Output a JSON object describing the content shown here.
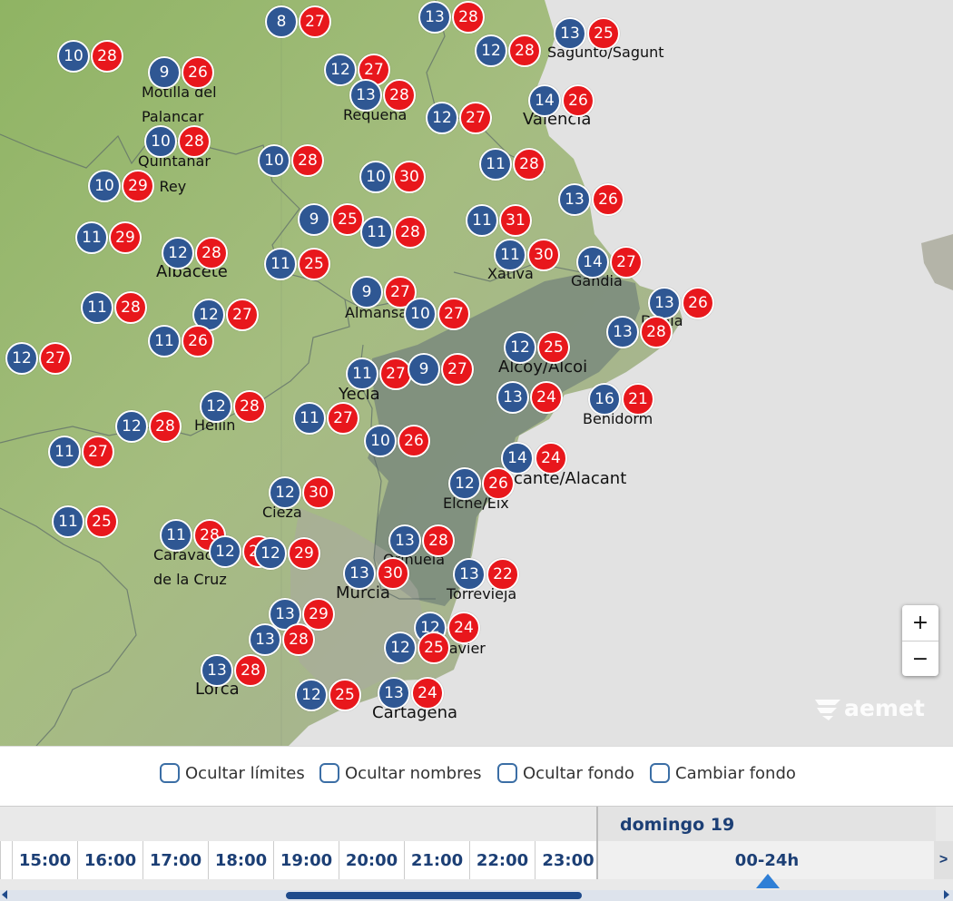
{
  "places": [
    {
      "id": "motilla",
      "text": "Motilla del",
      "size": "n"
    },
    {
      "id": "palancar",
      "text": "Palancar",
      "size": "n"
    },
    {
      "id": "quintanar",
      "text": "Quintanar",
      "size": "n"
    },
    {
      "id": "rey",
      "text": "l Rey",
      "size": "n"
    },
    {
      "id": "requena",
      "text": "Requena",
      "size": "n"
    },
    {
      "id": "sagunto",
      "text": "Sagunto/Sagunt",
      "size": "n"
    },
    {
      "id": "valencia",
      "text": "Valencia",
      "size": "b"
    },
    {
      "id": "albacete",
      "text": "Albacete",
      "size": "b"
    },
    {
      "id": "xativa",
      "text": "Xativa",
      "size": "n"
    },
    {
      "id": "gandia",
      "text": "Gandia",
      "size": "n"
    },
    {
      "id": "almansa",
      "text": "Almansa",
      "size": "n"
    },
    {
      "id": "denia",
      "text": "Denia",
      "size": "n"
    },
    {
      "id": "alcoy",
      "text": "Alcoy/Alcoi",
      "size": "b"
    },
    {
      "id": "yecla",
      "text": "Yecla",
      "size": "b"
    },
    {
      "id": "hellin",
      "text": "Hellín",
      "size": "n"
    },
    {
      "id": "benidorm",
      "text": "Benidorm",
      "size": "n"
    },
    {
      "id": "alicante",
      "text": "cante/Alacant",
      "size": "b"
    },
    {
      "id": "elche",
      "text": "Elche/Elx",
      "size": "n"
    },
    {
      "id": "cieza",
      "text": "Cieza",
      "size": "n"
    },
    {
      "id": "caravaca",
      "text": "Caravaca",
      "size": "n"
    },
    {
      "id": "delacruz",
      "text": "de la Cruz",
      "size": "n"
    },
    {
      "id": "orihuela",
      "text": "Orihuela",
      "size": "n"
    },
    {
      "id": "torrevieja",
      "text": "Torrevieja",
      "size": "n"
    },
    {
      "id": "murcia",
      "text": "Murcia",
      "size": "b"
    },
    {
      "id": "javier",
      "text": "Javier",
      "size": "n"
    },
    {
      "id": "lorca",
      "text": "Lorca",
      "size": "b"
    },
    {
      "id": "cartagena",
      "text": "Cartagena",
      "size": "b"
    }
  ],
  "stations": [
    {
      "min": "8",
      "max": "27"
    },
    {
      "min": "13",
      "max": "28"
    },
    {
      "min": "10",
      "max": "28"
    },
    {
      "min": "12",
      "max": "28"
    },
    {
      "min": "13",
      "max": "25"
    },
    {
      "min": "9",
      "max": "26"
    },
    {
      "min": "12",
      "max": "27"
    },
    {
      "min": "13",
      "max": "28"
    },
    {
      "min": "14",
      "max": "26"
    },
    {
      "min": "12",
      "max": "27"
    },
    {
      "min": "10",
      "max": "28"
    },
    {
      "min": "10",
      "max": "28"
    },
    {
      "min": "11",
      "max": "28"
    },
    {
      "min": "10",
      "max": "30"
    },
    {
      "min": "10",
      "max": "29"
    },
    {
      "min": "13",
      "max": "26"
    },
    {
      "min": "9",
      "max": "25"
    },
    {
      "min": "11",
      "max": "28"
    },
    {
      "min": "11",
      "max": "31"
    },
    {
      "min": "11",
      "max": "29"
    },
    {
      "min": "12",
      "max": "28"
    },
    {
      "min": "11",
      "max": "25"
    },
    {
      "min": "11",
      "max": "30"
    },
    {
      "min": "14",
      "max": "27"
    },
    {
      "min": "9",
      "max": "27"
    },
    {
      "min": "11",
      "max": "28"
    },
    {
      "min": "12",
      "max": "27"
    },
    {
      "min": "10",
      "max": "27"
    },
    {
      "min": "13",
      "max": "26"
    },
    {
      "min": "13",
      "max": "28"
    },
    {
      "min": "11",
      "max": "26"
    },
    {
      "min": "12",
      "max": "27"
    },
    {
      "min": "12",
      "max": "25"
    },
    {
      "min": "11",
      "max": "27"
    },
    {
      "min": "9",
      "max": "27"
    },
    {
      "min": "12",
      "max": "28"
    },
    {
      "min": "13",
      "max": "24"
    },
    {
      "min": "16",
      "max": "21"
    },
    {
      "min": "12",
      "max": "28"
    },
    {
      "min": "11",
      "max": "27"
    },
    {
      "min": "11",
      "max": "27"
    },
    {
      "min": "10",
      "max": "26"
    },
    {
      "min": "14",
      "max": "24"
    },
    {
      "min": "12",
      "max": "26"
    },
    {
      "min": "12",
      "max": "30"
    },
    {
      "min": "11",
      "max": "25"
    },
    {
      "min": "11",
      "max": "28"
    },
    {
      "min": "13",
      "max": "28"
    },
    {
      "min": "12",
      "max": "28"
    },
    {
      "min": "12",
      "max": "29"
    },
    {
      "min": "13",
      "max": "30"
    },
    {
      "min": "13",
      "max": "22"
    },
    {
      "min": "13",
      "max": "29"
    },
    {
      "min": "12",
      "max": "24"
    },
    {
      "min": "13",
      "max": "28"
    },
    {
      "min": "12",
      "max": "25"
    },
    {
      "min": "13",
      "max": "28"
    },
    {
      "min": "12",
      "max": "25"
    },
    {
      "min": "13",
      "max": "24"
    }
  ],
  "zoom": {
    "in": "+",
    "out": "−"
  },
  "logo": "aemet",
  "options": [
    {
      "label": "Ocultar límites"
    },
    {
      "label": "Ocultar nombres"
    },
    {
      "label": "Ocultar fondo"
    },
    {
      "label": "Cambiar fondo"
    }
  ],
  "timeline": {
    "day": "domingo 19",
    "hours": [
      "15:00",
      "16:00",
      "17:00",
      "18:00",
      "19:00",
      "20:00",
      "21:00",
      "22:00",
      "23:00"
    ],
    "selected": "00-24h",
    "next_arrow": ">"
  }
}
